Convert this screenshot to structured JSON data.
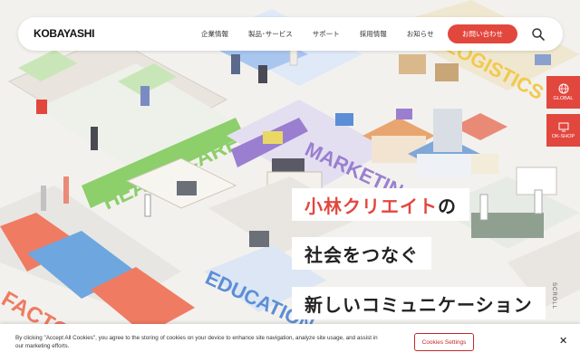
{
  "header": {
    "logo": "KOBAYASHI",
    "nav": [
      "企業情報",
      "製品･サービス",
      "サポート",
      "採用情報",
      "お知らせ"
    ],
    "contact_label": "お問い合わせ",
    "search_icon": "search-icon"
  },
  "side_tabs": [
    {
      "label": "GLOBAL",
      "icon": "globe-icon"
    },
    {
      "label": "OK-SHOP",
      "icon": "monitor-icon"
    }
  ],
  "hero": {
    "line1_accent": "小林クリエイト",
    "line1_rest": "の",
    "line2": "社会をつなぐ",
    "line3": "新しいコミュニケーション",
    "scroll_label": "SCROLL",
    "illustration_labels": [
      "HEALTHCARE",
      "MARKETING",
      "LOGISTICS",
      "EDUCATION",
      "FACTORY"
    ]
  },
  "cookie": {
    "text": "By clicking \"Accept All Cookies\", you agree to the storing of cookies on your device to enhance site navigation, analyze site usage, and assist in our marketing efforts.",
    "settings_label": "Cookies Settings",
    "close_label": "✕"
  },
  "colors": {
    "accent": "#e2473e",
    "healthcare": "#8ccf6b",
    "marketing": "#9a7fd1",
    "logistics": "#f2c94c",
    "education": "#5b8ed6",
    "factory": "#ef7b62"
  }
}
